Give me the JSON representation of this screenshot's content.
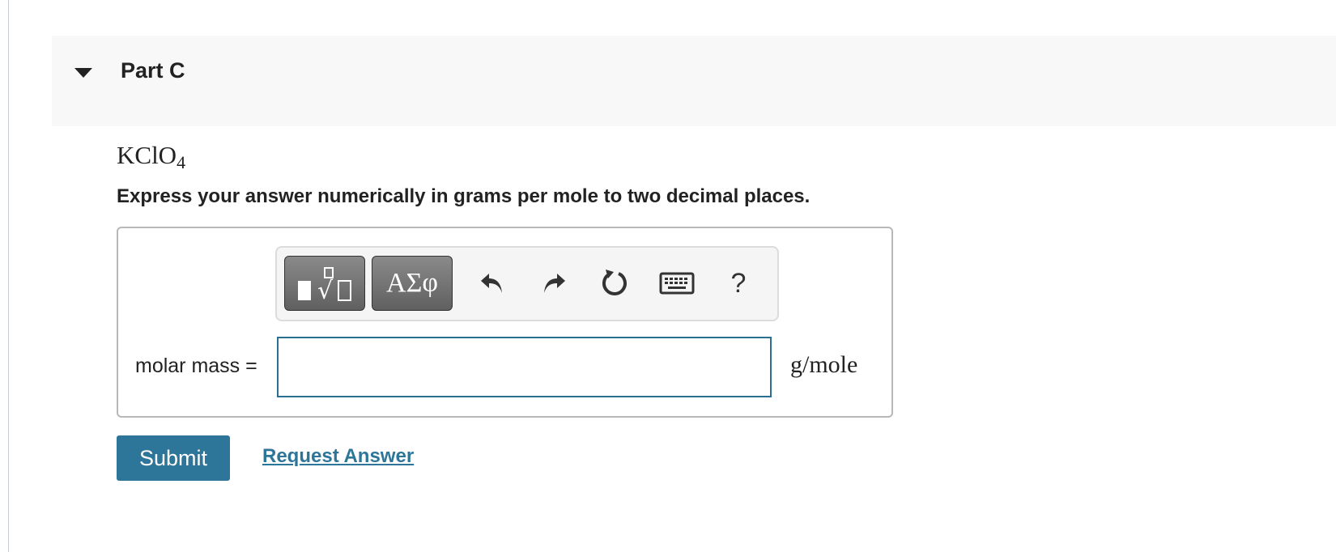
{
  "part": {
    "title": "Part C"
  },
  "question": {
    "formula_main": "KClO",
    "formula_sub": "4",
    "instructions": "Express your answer numerically in grams per mole to two decimal places."
  },
  "toolbar": {
    "symbols_label": "ΑΣφ",
    "help_label": "?",
    "icons": [
      "templates-icon",
      "greek-symbols",
      "undo-icon",
      "redo-icon",
      "reset-icon",
      "keyboard-icon",
      "help-icon"
    ]
  },
  "answer": {
    "label": "molar mass =",
    "value": "",
    "units": "g/mole"
  },
  "actions": {
    "submit_label": "Submit",
    "request_label": "Request Answer"
  },
  "colors": {
    "accent": "#2e7699",
    "input_border": "#2a6f8f",
    "header_bg": "#f8f8f8"
  }
}
